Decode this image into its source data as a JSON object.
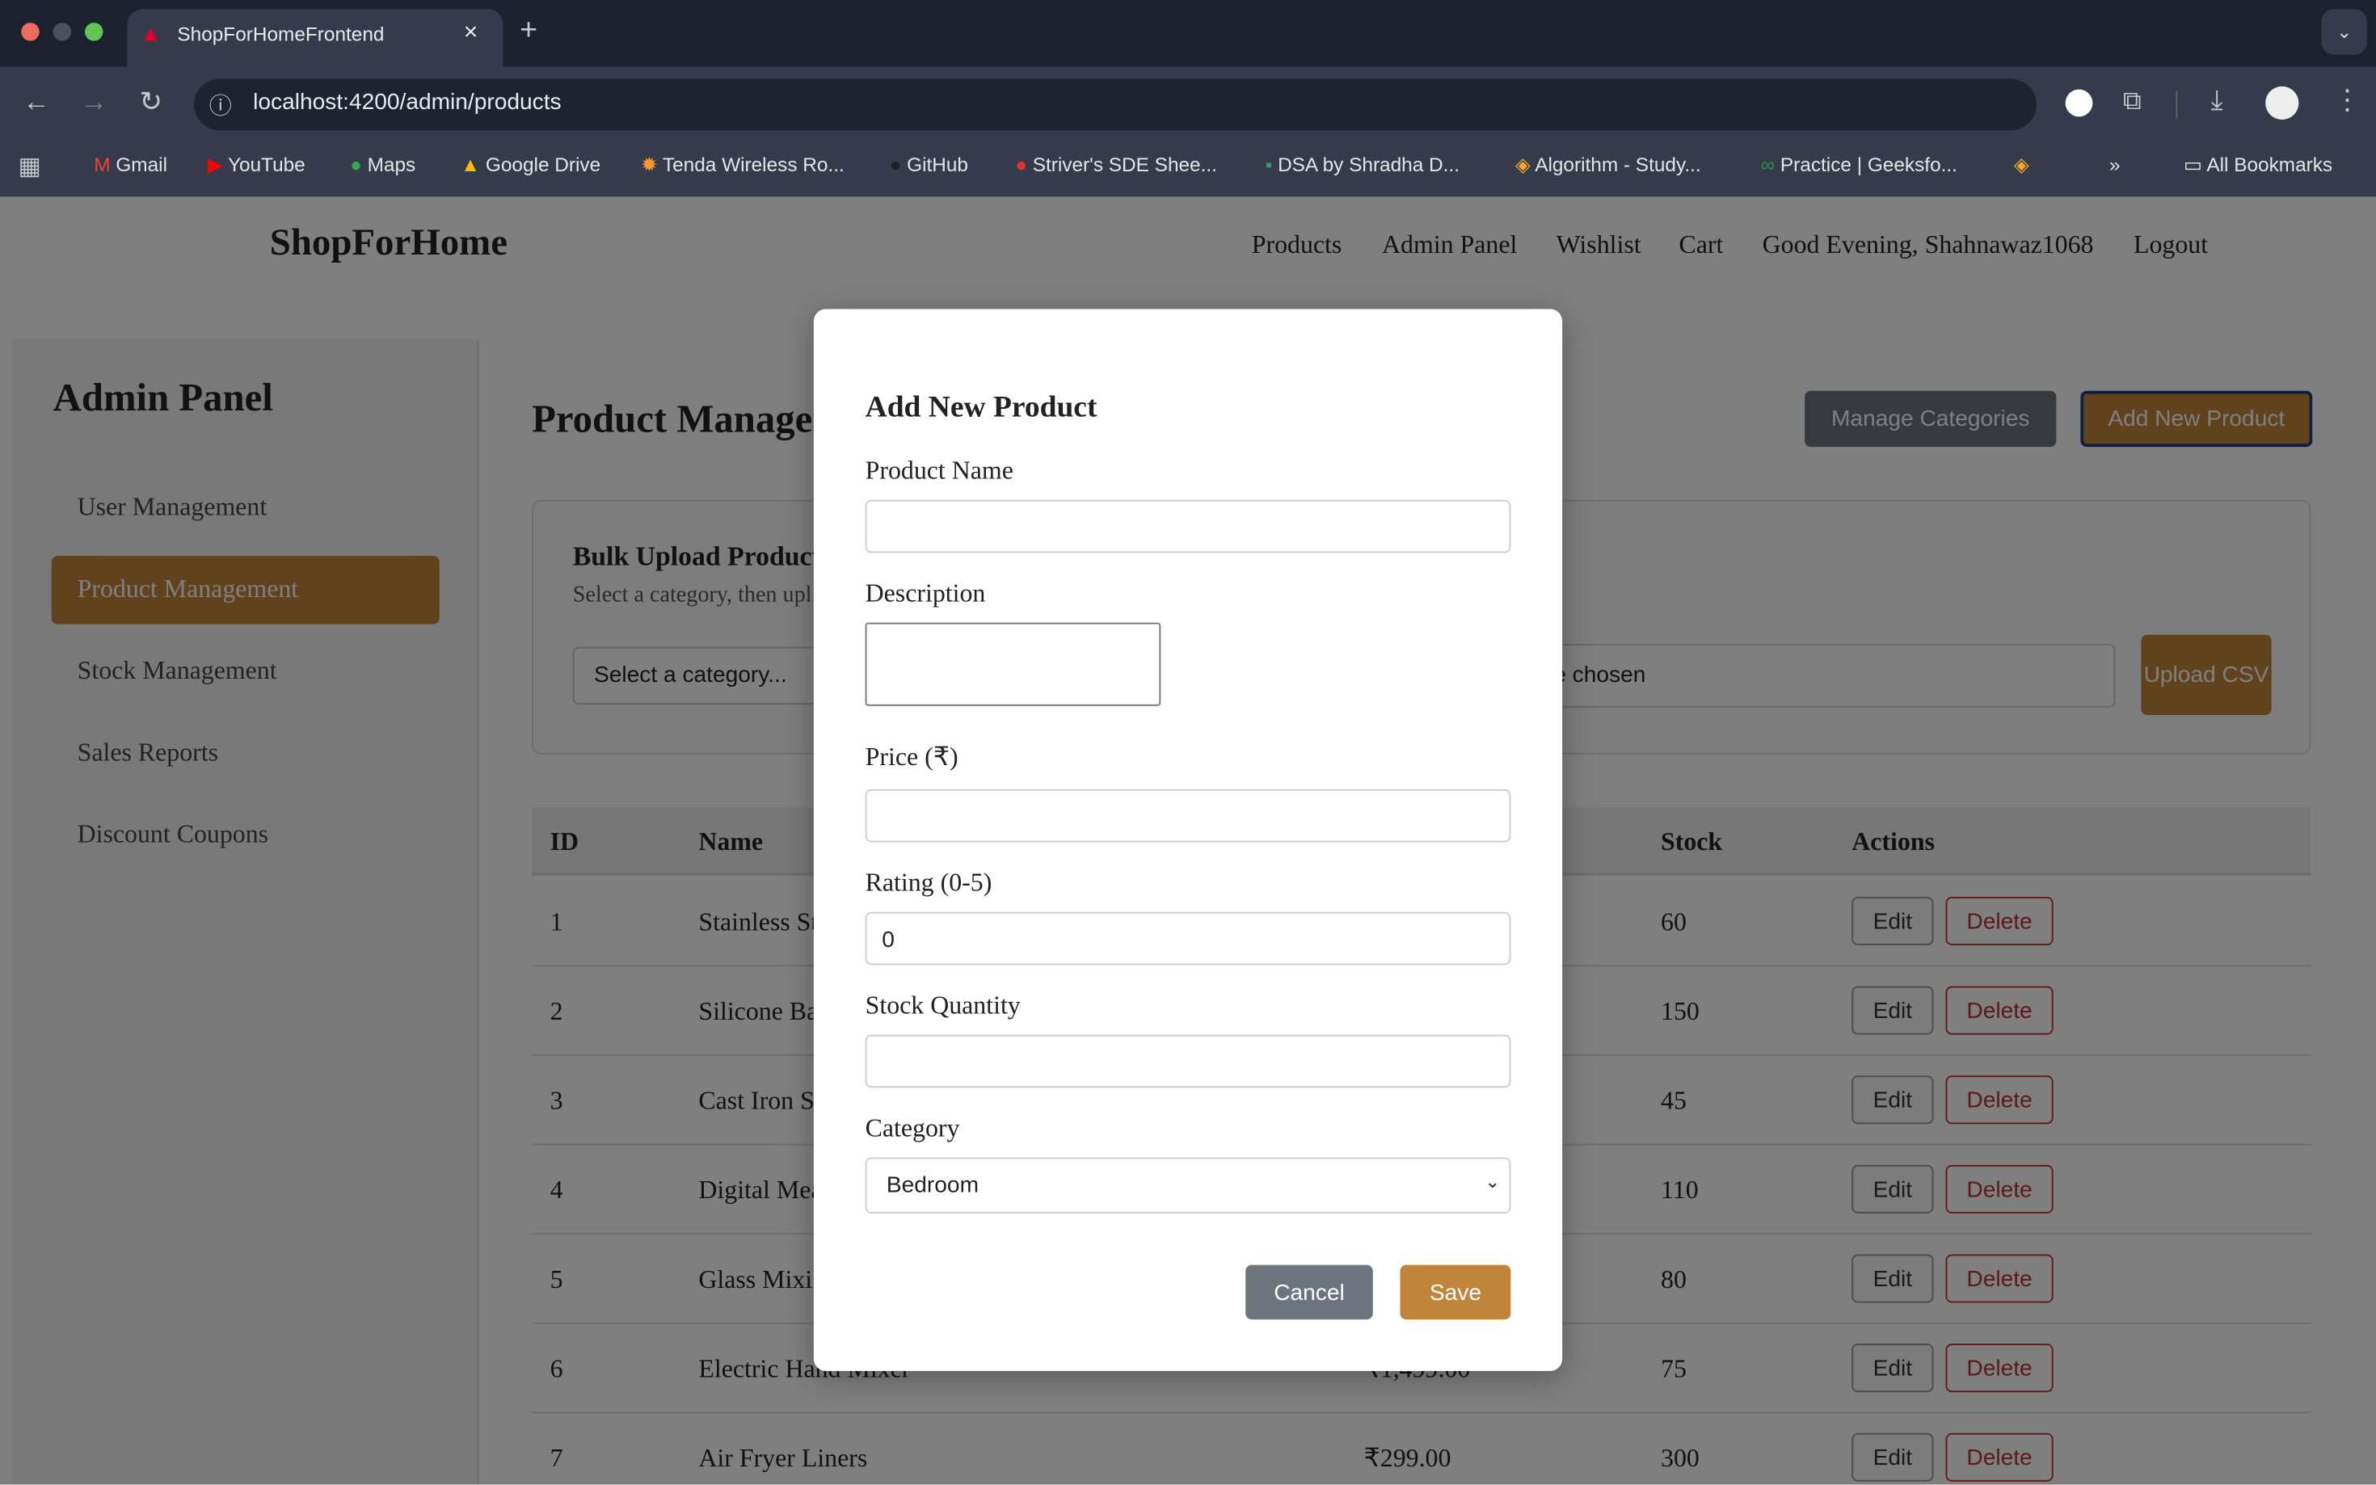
{
  "browser": {
    "tab_title": "ShopForHomeFrontend",
    "url": "localhost:4200/admin/products",
    "bookmarks": [
      "Gmail",
      "YouTube",
      "Maps",
      "Google Drive",
      "Tenda Wireless Ro...",
      "GitHub",
      "Striver's SDE Shee...",
      "DSA by Shradha D...",
      "Algorithm - Study...",
      "Practice | Geeksfo..."
    ],
    "all_bookmarks": "All Bookmarks"
  },
  "navbar": {
    "brand": "ShopForHome",
    "links": [
      "Products",
      "Admin Panel",
      "Wishlist",
      "Cart",
      "Good Evening, Shahnawaz1068",
      "Logout"
    ]
  },
  "sidebar": {
    "title": "Admin Panel",
    "items": [
      {
        "label": "User Management",
        "active": false
      },
      {
        "label": "Product Management",
        "active": true
      },
      {
        "label": "Stock Management",
        "active": false
      },
      {
        "label": "Sales Reports",
        "active": false
      },
      {
        "label": "Discount Coupons",
        "active": false
      }
    ]
  },
  "main": {
    "title": "Product Management",
    "manage_categories": "Manage Categories",
    "add_new_product": "Add New Product",
    "bulk": {
      "title": "Bulk Upload Products",
      "hint": "Select a category, then upl",
      "category_placeholder": "Select a category...",
      "file_status": "No file chosen",
      "upload_label": "Upload CSV"
    },
    "table": {
      "headers": {
        "id": "ID",
        "name": "Name",
        "stock": "Stock",
        "actions": "Actions"
      },
      "edit_label": "Edit",
      "delete_label": "Delete",
      "rows": [
        {
          "id": "1",
          "name": "Stainless St",
          "price": "",
          "stock": "60"
        },
        {
          "id": "2",
          "name": "Silicone Ba",
          "price": "",
          "stock": "150"
        },
        {
          "id": "3",
          "name": "Cast Iron S",
          "price": "",
          "stock": "45"
        },
        {
          "id": "4",
          "name": "Digital Mea",
          "price": "",
          "stock": "110"
        },
        {
          "id": "5",
          "name": "Glass Mixi",
          "price": "",
          "stock": "80"
        },
        {
          "id": "6",
          "name": "Electric Hand Mixer",
          "price": "₹1,499.00",
          "stock": "75"
        },
        {
          "id": "7",
          "name": "Air Fryer Liners",
          "price": "₹299.00",
          "stock": "300"
        }
      ]
    }
  },
  "modal": {
    "title": "Add New Product",
    "product_name_label": "Product Name",
    "product_name_value": "",
    "description_label": "Description",
    "description_value": "",
    "price_label": "Price (₹)",
    "price_value": "",
    "rating_label": "Rating (0-5)",
    "rating_value": "0",
    "stock_label": "Stock Quantity",
    "stock_value": "",
    "category_label": "Category",
    "category_value": "Bedroom",
    "cancel_label": "Cancel",
    "save_label": "Save"
  },
  "colors": {
    "accent": "#c0843a",
    "danger": "#b33333",
    "secondary": "#6c757d"
  }
}
